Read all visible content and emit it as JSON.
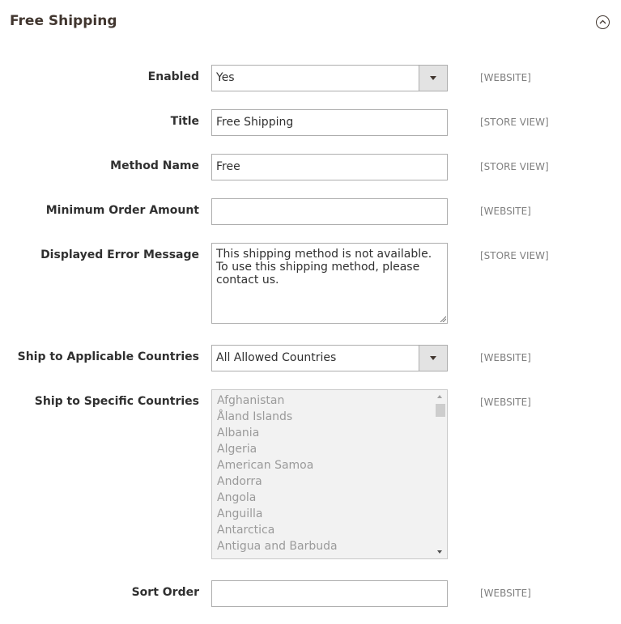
{
  "section": {
    "title": "Free Shipping"
  },
  "fields": {
    "enabled": {
      "label": "Enabled",
      "value": "Yes",
      "scope": "[WEBSITE]"
    },
    "title": {
      "label": "Title",
      "value": "Free Shipping",
      "scope": "[STORE VIEW]"
    },
    "method_name": {
      "label": "Method Name",
      "value": "Free",
      "scope": "[STORE VIEW]"
    },
    "min_order": {
      "label": "Minimum Order Amount",
      "value": "",
      "scope": "[WEBSITE]"
    },
    "error_message": {
      "label": "Displayed Error Message",
      "value": "This shipping method is not available. To use this shipping method, please contact us.",
      "scope": "[STORE VIEW]"
    },
    "applicable_countries": {
      "label": "Ship to Applicable Countries",
      "value": "All Allowed Countries",
      "scope": "[WEBSITE]"
    },
    "specific_countries": {
      "label": "Ship to Specific Countries",
      "scope": "[WEBSITE]",
      "options": [
        "Afghanistan",
        "Åland Islands",
        "Albania",
        "Algeria",
        "American Samoa",
        "Andorra",
        "Angola",
        "Anguilla",
        "Antarctica",
        "Antigua and Barbuda"
      ]
    },
    "sort_order": {
      "label": "Sort Order",
      "value": "",
      "scope": "[WEBSITE]"
    }
  },
  "icons": {
    "collapse": "chevron-up-circle-icon",
    "select_arrow": "triangle-down-icon"
  }
}
